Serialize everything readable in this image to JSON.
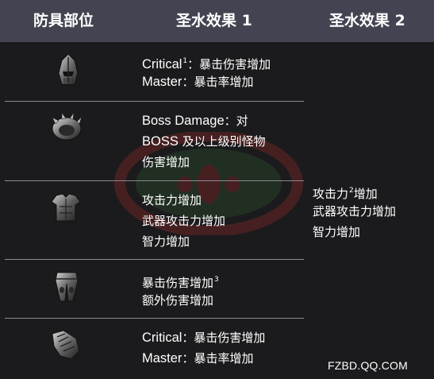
{
  "header": {
    "col_part": "防具部位",
    "col_effect1": "圣水效果 1",
    "col_effect2": "圣水效果 2"
  },
  "rows": [
    {
      "icon": "helmet-icon",
      "lines": [
        {
          "en": "Critical",
          "sup": "1",
          "zh": "：暴击伤害增加"
        },
        {
          "en": "Master",
          "zh": "：暴击率增加"
        }
      ]
    },
    {
      "icon": "shoulder-guard-icon",
      "lines": [
        {
          "en": "Boss Damage",
          "zh": "：对"
        },
        {
          "en": "BOSS",
          "zh": " 及以上级别怪物"
        },
        {
          "zh": "伤害增加"
        }
      ]
    },
    {
      "icon": "chest-armor-icon",
      "lines": [
        {
          "zh": "攻击力增加"
        },
        {
          "zh": "武器攻击力增加"
        },
        {
          "zh": "智力增加"
        }
      ]
    },
    {
      "icon": "leg-armor-icon",
      "lines": [
        {
          "zh": "暴击伤害增加",
          "sup": "3"
        },
        {
          "zh": "额外伤害增加"
        }
      ]
    },
    {
      "icon": "gauntlet-icon",
      "lines": [
        {
          "en": "Critical",
          "zh": "：暴击伤害增加"
        },
        {
          "en": "Master",
          "zh": "：暴击率增加"
        }
      ]
    }
  ],
  "effect2": {
    "line1": "攻击力",
    "line1_sup": "2",
    "line1_suffix": "增加",
    "line2": "武器攻击力增加",
    "line3": "智力增加"
  },
  "footer": {
    "site": "FZBD.QQ.COM"
  },
  "colors": {
    "header_bg": "#434451",
    "page_bg": "#1b1b1d",
    "divider": "#8a8a90",
    "watermark_red": "#a02b2b",
    "watermark_green": "#2e5a2e"
  }
}
